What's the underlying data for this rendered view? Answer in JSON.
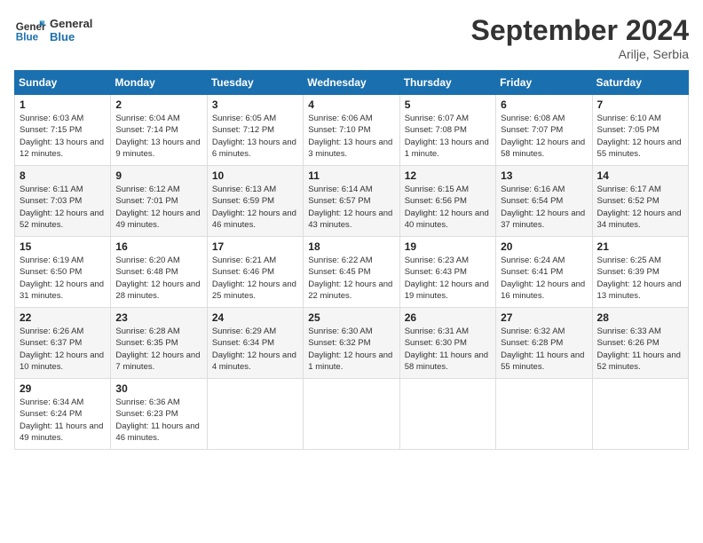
{
  "header": {
    "logo_general": "General",
    "logo_blue": "Blue",
    "month_title": "September 2024",
    "subtitle": "Arilje, Serbia"
  },
  "weekdays": [
    "Sunday",
    "Monday",
    "Tuesday",
    "Wednesday",
    "Thursday",
    "Friday",
    "Saturday"
  ],
  "weeks": [
    [
      {
        "day": "1",
        "sunrise": "6:03 AM",
        "sunset": "7:15 PM",
        "daylight": "13 hours and 12 minutes."
      },
      {
        "day": "2",
        "sunrise": "6:04 AM",
        "sunset": "7:14 PM",
        "daylight": "13 hours and 9 minutes."
      },
      {
        "day": "3",
        "sunrise": "6:05 AM",
        "sunset": "7:12 PM",
        "daylight": "13 hours and 6 minutes."
      },
      {
        "day": "4",
        "sunrise": "6:06 AM",
        "sunset": "7:10 PM",
        "daylight": "13 hours and 3 minutes."
      },
      {
        "day": "5",
        "sunrise": "6:07 AM",
        "sunset": "7:08 PM",
        "daylight": "13 hours and 1 minute."
      },
      {
        "day": "6",
        "sunrise": "6:08 AM",
        "sunset": "7:07 PM",
        "daylight": "12 hours and 58 minutes."
      },
      {
        "day": "7",
        "sunrise": "6:10 AM",
        "sunset": "7:05 PM",
        "daylight": "12 hours and 55 minutes."
      }
    ],
    [
      {
        "day": "8",
        "sunrise": "6:11 AM",
        "sunset": "7:03 PM",
        "daylight": "12 hours and 52 minutes."
      },
      {
        "day": "9",
        "sunrise": "6:12 AM",
        "sunset": "7:01 PM",
        "daylight": "12 hours and 49 minutes."
      },
      {
        "day": "10",
        "sunrise": "6:13 AM",
        "sunset": "6:59 PM",
        "daylight": "12 hours and 46 minutes."
      },
      {
        "day": "11",
        "sunrise": "6:14 AM",
        "sunset": "6:57 PM",
        "daylight": "12 hours and 43 minutes."
      },
      {
        "day": "12",
        "sunrise": "6:15 AM",
        "sunset": "6:56 PM",
        "daylight": "12 hours and 40 minutes."
      },
      {
        "day": "13",
        "sunrise": "6:16 AM",
        "sunset": "6:54 PM",
        "daylight": "12 hours and 37 minutes."
      },
      {
        "day": "14",
        "sunrise": "6:17 AM",
        "sunset": "6:52 PM",
        "daylight": "12 hours and 34 minutes."
      }
    ],
    [
      {
        "day": "15",
        "sunrise": "6:19 AM",
        "sunset": "6:50 PM",
        "daylight": "12 hours and 31 minutes."
      },
      {
        "day": "16",
        "sunrise": "6:20 AM",
        "sunset": "6:48 PM",
        "daylight": "12 hours and 28 minutes."
      },
      {
        "day": "17",
        "sunrise": "6:21 AM",
        "sunset": "6:46 PM",
        "daylight": "12 hours and 25 minutes."
      },
      {
        "day": "18",
        "sunrise": "6:22 AM",
        "sunset": "6:45 PM",
        "daylight": "12 hours and 22 minutes."
      },
      {
        "day": "19",
        "sunrise": "6:23 AM",
        "sunset": "6:43 PM",
        "daylight": "12 hours and 19 minutes."
      },
      {
        "day": "20",
        "sunrise": "6:24 AM",
        "sunset": "6:41 PM",
        "daylight": "12 hours and 16 minutes."
      },
      {
        "day": "21",
        "sunrise": "6:25 AM",
        "sunset": "6:39 PM",
        "daylight": "12 hours and 13 minutes."
      }
    ],
    [
      {
        "day": "22",
        "sunrise": "6:26 AM",
        "sunset": "6:37 PM",
        "daylight": "12 hours and 10 minutes."
      },
      {
        "day": "23",
        "sunrise": "6:28 AM",
        "sunset": "6:35 PM",
        "daylight": "12 hours and 7 minutes."
      },
      {
        "day": "24",
        "sunrise": "6:29 AM",
        "sunset": "6:34 PM",
        "daylight": "12 hours and 4 minutes."
      },
      {
        "day": "25",
        "sunrise": "6:30 AM",
        "sunset": "6:32 PM",
        "daylight": "12 hours and 1 minute."
      },
      {
        "day": "26",
        "sunrise": "6:31 AM",
        "sunset": "6:30 PM",
        "daylight": "11 hours and 58 minutes."
      },
      {
        "day": "27",
        "sunrise": "6:32 AM",
        "sunset": "6:28 PM",
        "daylight": "11 hours and 55 minutes."
      },
      {
        "day": "28",
        "sunrise": "6:33 AM",
        "sunset": "6:26 PM",
        "daylight": "11 hours and 52 minutes."
      }
    ],
    [
      {
        "day": "29",
        "sunrise": "6:34 AM",
        "sunset": "6:24 PM",
        "daylight": "11 hours and 49 minutes."
      },
      {
        "day": "30",
        "sunrise": "6:36 AM",
        "sunset": "6:23 PM",
        "daylight": "11 hours and 46 minutes."
      },
      null,
      null,
      null,
      null,
      null
    ]
  ]
}
